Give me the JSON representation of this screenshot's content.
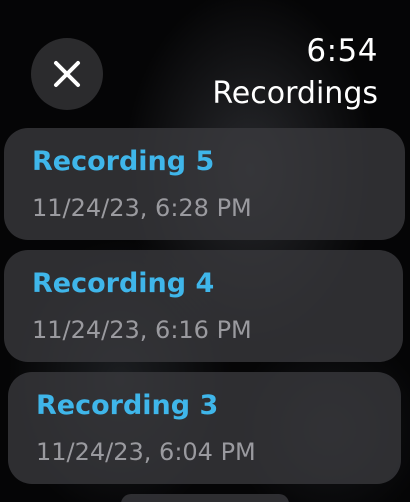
{
  "header": {
    "time": "6:54",
    "title": "Recordings"
  },
  "close_button": {
    "icon": "close-icon"
  },
  "recordings": [
    {
      "title": "Recording 5",
      "date": "11/24/23, 6:28 PM"
    },
    {
      "title": "Recording 4",
      "date": "11/24/23, 6:16 PM"
    },
    {
      "title": "Recording 3",
      "date": "11/24/23, 6:04 PM"
    }
  ],
  "colors": {
    "accent": "#3fb6ea",
    "card": "#3a3a3e",
    "secondary_text": "#9a9a9f",
    "background": "#000000"
  }
}
